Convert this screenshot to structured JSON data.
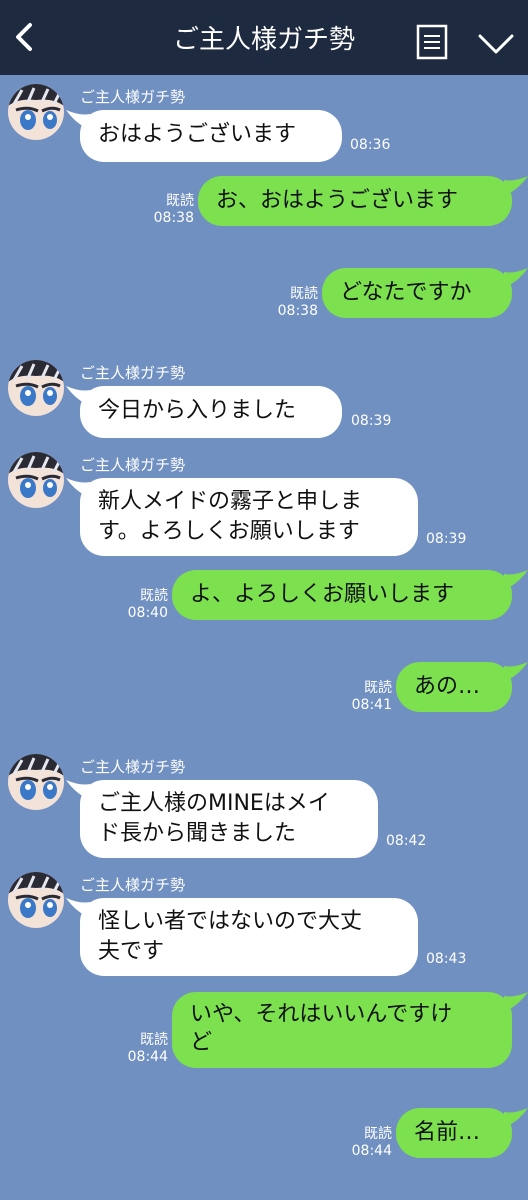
{
  "header": {
    "title": "ご主人様ガチ勢"
  },
  "messages": [
    {
      "side": "in",
      "sender": "ご主人様ガチ勢",
      "text": "おはようございます",
      "time": "08:36"
    },
    {
      "side": "out",
      "read": "既読",
      "text": "お、おはようございます",
      "time": "08:38"
    },
    {
      "side": "out",
      "read": "既読",
      "text": "どなたですか",
      "time": "08:38"
    },
    {
      "side": "in",
      "sender": "ご主人様ガチ勢",
      "text": "今日から入りました",
      "time": "08:39"
    },
    {
      "side": "in",
      "sender": "ご主人様ガチ勢",
      "text": "新人メイドの霧子と申しま\nす。よろしくお願いします",
      "time": "08:39"
    },
    {
      "side": "out",
      "read": "既読",
      "text": "よ、よろしくお願いします",
      "time": "08:40"
    },
    {
      "side": "out",
      "read": "既読",
      "text": "あの…",
      "time": "08:41"
    },
    {
      "side": "in",
      "sender": "ご主人様ガチ勢",
      "text": "ご主人様のMINEはメイ\nド長から聞きました",
      "time": "08:42"
    },
    {
      "side": "in",
      "sender": "ご主人様ガチ勢",
      "text": "怪しい者ではないので大丈\n夫です",
      "time": "08:43"
    },
    {
      "side": "out",
      "read": "既読",
      "text": "いや、それはいいんですけ\nど",
      "time": "08:44"
    },
    {
      "side": "out",
      "read": "既読",
      "text": "名前…",
      "time": "08:44"
    }
  ],
  "colors": {
    "header": "#1e2a40",
    "background": "#7090c2",
    "outgoing": "#7de04f",
    "incoming": "#ffffff"
  },
  "icons": {
    "back": "chevron-left-icon",
    "note": "note-icon",
    "menu": "chevron-down-icon"
  }
}
